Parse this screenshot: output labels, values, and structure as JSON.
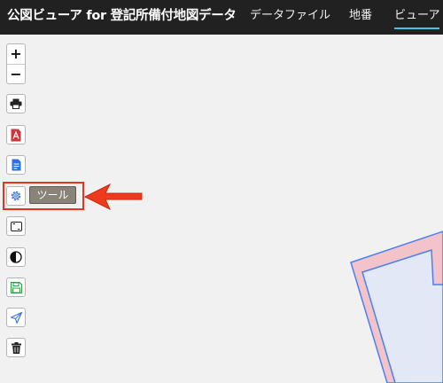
{
  "header": {
    "title": "公図ビューア for 登記所備付地図データ",
    "tabs": [
      {
        "label": "データファイル",
        "active": false
      },
      {
        "label": "地番",
        "active": false
      },
      {
        "label": "ビューア",
        "active": true
      }
    ]
  },
  "map_controls": {
    "zoom_in": "+",
    "zoom_out": "−",
    "buttons": [
      {
        "name": "print-button",
        "icon": "printer-icon"
      },
      {
        "name": "pdf-button",
        "icon": "pdf-icon"
      },
      {
        "name": "document-button",
        "icon": "document-icon"
      },
      {
        "name": "tool-button",
        "icon": "gear-icon"
      },
      {
        "name": "frame-button",
        "icon": "frame-icon"
      },
      {
        "name": "contrast-button",
        "icon": "contrast-icon"
      },
      {
        "name": "save-button",
        "icon": "save-icon"
      },
      {
        "name": "send-button",
        "icon": "send-icon"
      },
      {
        "name": "delete-button",
        "icon": "trash-icon"
      }
    ]
  },
  "tooltip": {
    "label": "ツール"
  },
  "colors": {
    "topbar": "#212121",
    "active_tab_underline": "#3ec7e6",
    "highlight": "#e8331c",
    "parcel_outline": "#4a80f0",
    "parcel_fill": "#f2c3c8",
    "parcel_inner_fill": "#e3e8f6"
  }
}
